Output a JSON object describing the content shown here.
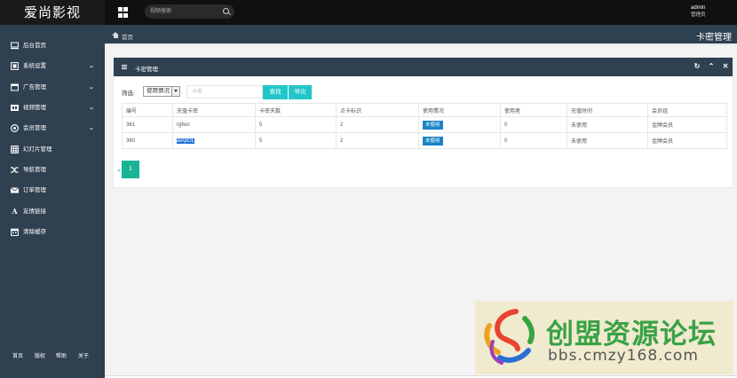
{
  "app": {
    "logo": "爱尚影视"
  },
  "search": {
    "placeholder": "视频搜索"
  },
  "user": {
    "name": "admin",
    "role": "管理员"
  },
  "sidebar": {
    "items": [
      {
        "label": "后台首页",
        "icon": "monitor-icon",
        "has_sub": false
      },
      {
        "label": "系统设置",
        "icon": "settings-icon",
        "has_sub": true
      },
      {
        "label": "广告管理",
        "icon": "ad-icon",
        "has_sub": true
      },
      {
        "label": "视频管理",
        "icon": "video-icon",
        "has_sub": true
      },
      {
        "label": "会员管理",
        "icon": "member-icon",
        "has_sub": true
      },
      {
        "label": "幻灯片管理",
        "icon": "slides-icon",
        "has_sub": false
      },
      {
        "label": "导航管理",
        "icon": "shuffle-icon",
        "has_sub": false
      },
      {
        "label": "订单管理",
        "icon": "envelope-icon",
        "has_sub": false
      },
      {
        "label": "友情链接",
        "icon": "font-icon",
        "has_sub": false
      },
      {
        "label": "清除缓存",
        "icon": "calendar-icon",
        "has_sub": false
      }
    ],
    "footer": [
      "首页",
      "版权",
      "帮助",
      "关于"
    ]
  },
  "breadcrumb": {
    "home": "首页"
  },
  "page": {
    "title": "卡密管理"
  },
  "panel": {
    "title": "卡密管理",
    "filter_label": "筛选:",
    "status_select": "使用情况",
    "card_input_placeholder": "卡密",
    "search_button": "查找",
    "export_button": "导出"
  },
  "table": {
    "headers": [
      "编号",
      "充值卡密",
      "卡密天数",
      "点卡标识",
      "使用情况",
      "使用者",
      "充值时间",
      "会员组"
    ],
    "rows": [
      {
        "id": "361",
        "card": "rgfwo",
        "days": "5",
        "flag": "2",
        "status": "未使用",
        "user": "0",
        "time": "未使用",
        "group": "金牌会员"
      },
      {
        "id": "360",
        "card": "alApGL",
        "days": "5",
        "flag": "2",
        "status": "未使用",
        "user": "0",
        "time": "未使用",
        "group": "金牌会员"
      }
    ]
  },
  "pagination": {
    "prev": "«",
    "current": "1"
  },
  "watermark": {
    "title": "创盟资源论坛",
    "url": "bbs.cmzy168.com"
  },
  "colors": {
    "sidebar": "#2f4050",
    "topbar": "#101010",
    "accent": "#1ab394",
    "info": "#23c6c8",
    "badge": "#1c84c6"
  }
}
